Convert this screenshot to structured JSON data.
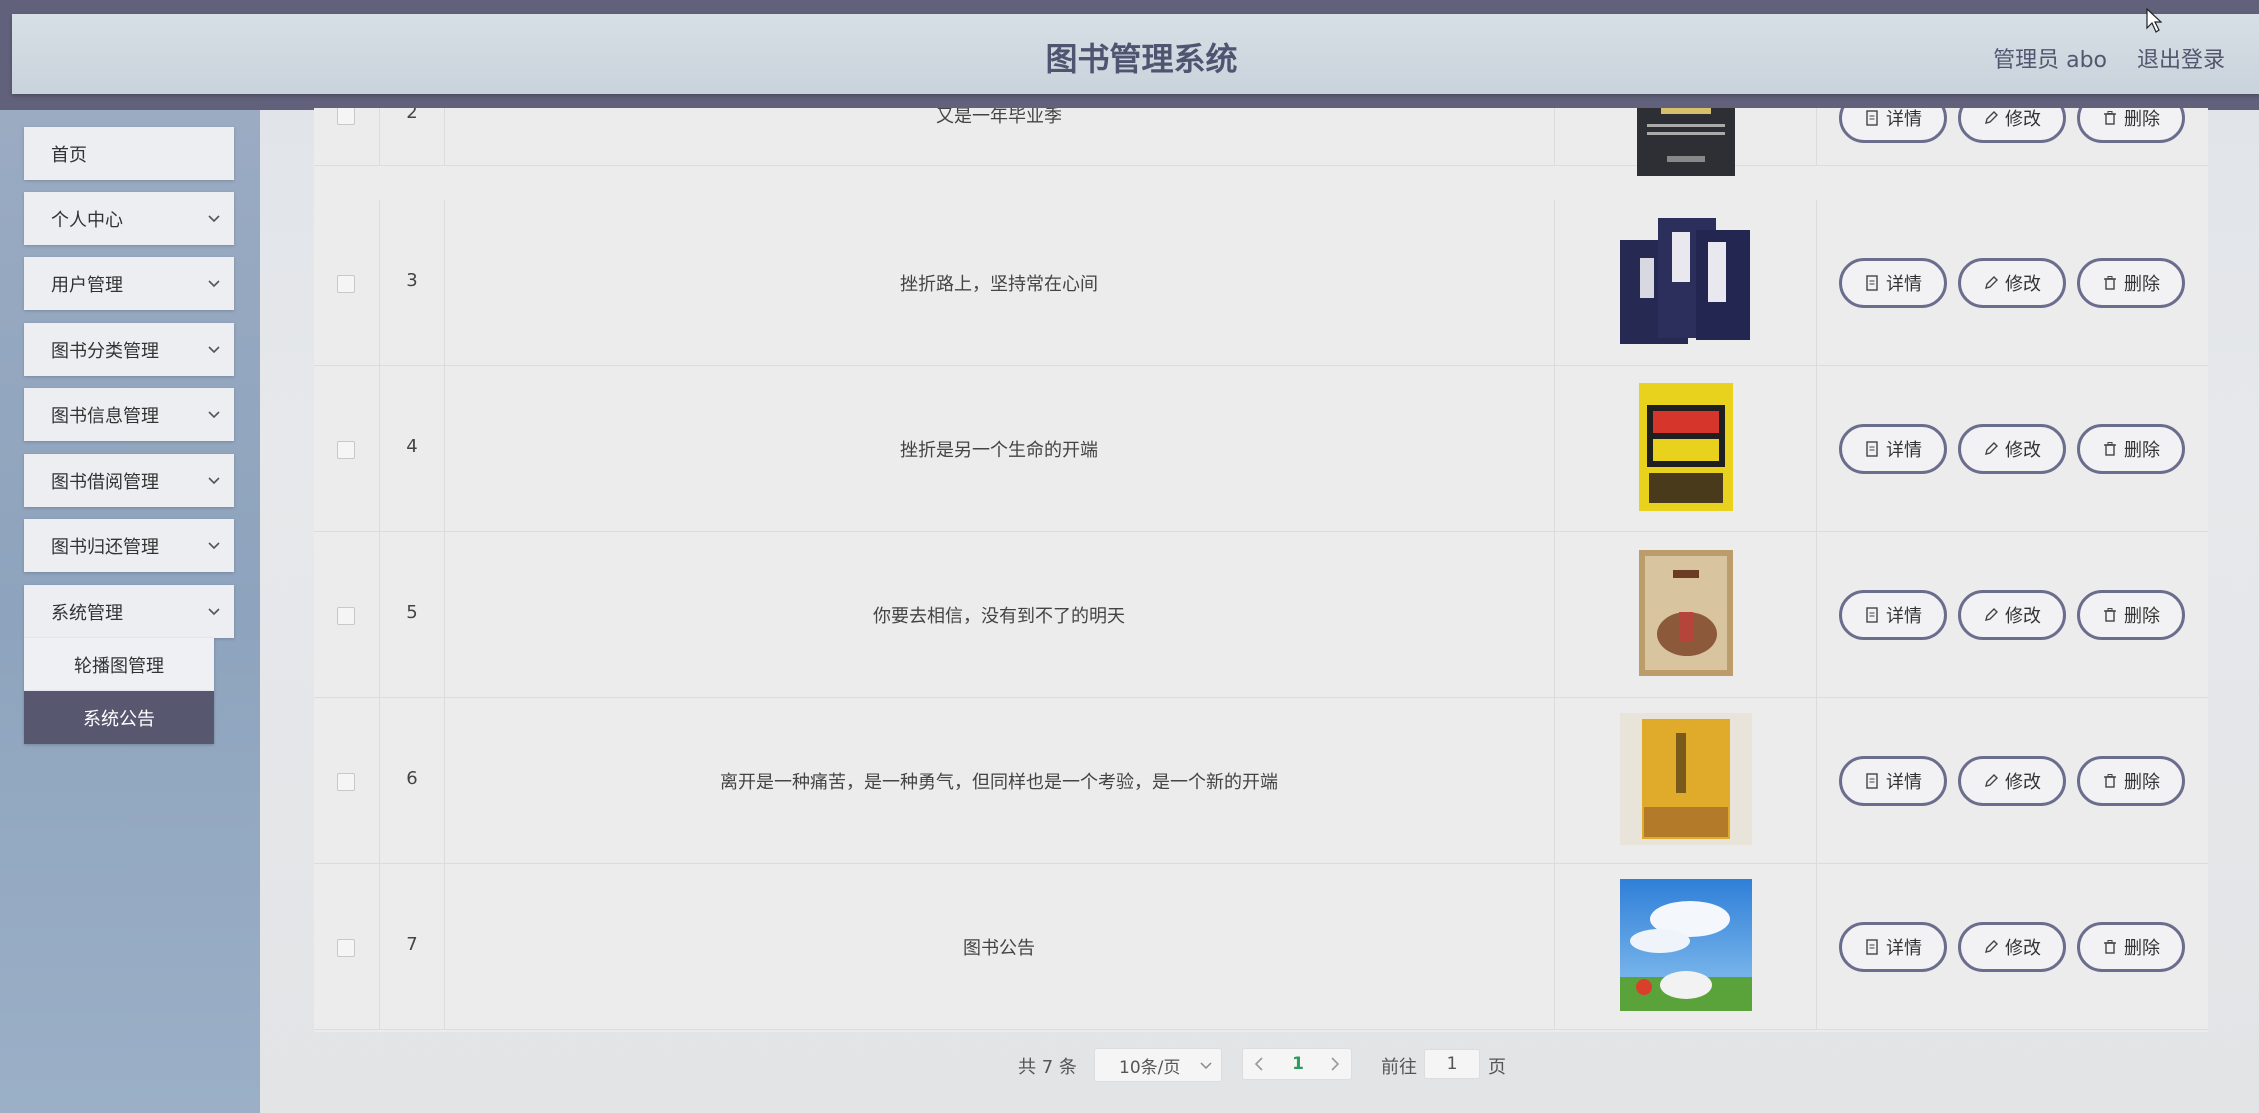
{
  "header": {
    "title": "图书管理系统",
    "user": "管理员 abo",
    "logout": "退出登录"
  },
  "sidebar": {
    "items": [
      {
        "label": "首页",
        "has_chevron": false
      },
      {
        "label": "个人中心",
        "has_chevron": true
      },
      {
        "label": "用户管理",
        "has_chevron": true
      },
      {
        "label": "图书分类管理",
        "has_chevron": true
      },
      {
        "label": "图书信息管理",
        "has_chevron": true
      },
      {
        "label": "图书借阅管理",
        "has_chevron": true
      },
      {
        "label": "图书归还管理",
        "has_chevron": true
      },
      {
        "label": "系统管理",
        "has_chevron": true
      }
    ],
    "submenu": [
      {
        "label": "轮播图管理",
        "active": false
      },
      {
        "label": "系统公告",
        "active": true
      }
    ]
  },
  "table": {
    "actions": {
      "detail": "详情",
      "edit": "修改",
      "delete": "删除"
    },
    "rows": [
      {
        "index": "2",
        "title": "又是一年毕业季",
        "cover": "dark-book"
      },
      {
        "index": "3",
        "title": "挫折路上，坚持常在心间",
        "cover": "navy-boxset"
      },
      {
        "index": "4",
        "title": "挫折是另一个生命的开端",
        "cover": "yellow-book"
      },
      {
        "index": "5",
        "title": "你要去相信，没有到不了的明天",
        "cover": "tan-book"
      },
      {
        "index": "6",
        "title": "离开是一种痛苦，是一种勇气，但同样也是一个考验，是一个新的开端",
        "cover": "gold-book"
      },
      {
        "index": "7",
        "title": "图书公告",
        "cover": "sky-picture"
      }
    ]
  },
  "pagination": {
    "total": "共 7 条",
    "page_size": "10条/页",
    "current_page": "1",
    "goto_label": "前往",
    "goto_value": "1",
    "page_suffix": "页"
  },
  "colors": {
    "accent": "#6b6d8d",
    "active_menu": "#57586f",
    "current_page": "#2e9c5e"
  }
}
